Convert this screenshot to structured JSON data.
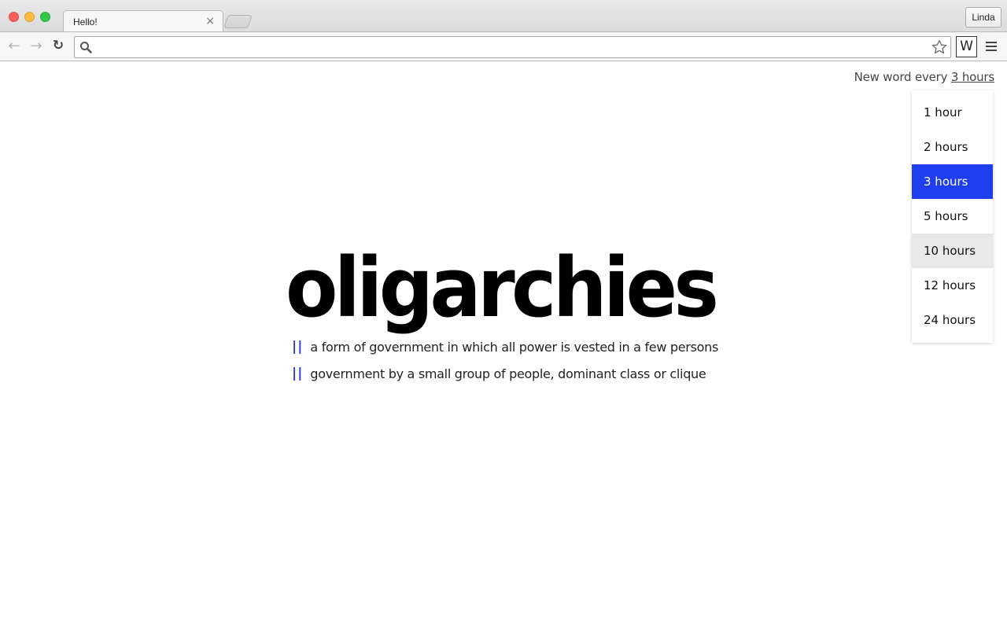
{
  "browser": {
    "tab_title": "Hello!",
    "tab_close": "×",
    "profile_name": "Linda",
    "address_value": "",
    "extension_label": "W",
    "nav": {
      "back_icon": "←",
      "forward_icon": "→",
      "reload_icon": "↻"
    }
  },
  "settings": {
    "prefix": "New word every ",
    "current": "3 hours",
    "options": [
      {
        "label": "1 hour",
        "state": "normal"
      },
      {
        "label": "2 hours",
        "state": "normal"
      },
      {
        "label": "3 hours",
        "state": "selected"
      },
      {
        "label": "5 hours",
        "state": "normal"
      },
      {
        "label": "10 hours",
        "state": "hover"
      },
      {
        "label": "12 hours",
        "state": "normal"
      },
      {
        "label": "24 hours",
        "state": "normal"
      }
    ]
  },
  "word": {
    "term": "oligarchies",
    "marker": "||",
    "definitions": [
      "a form of government in which all power is vested in a few persons",
      "government by a small group of people, dominant class or clique"
    ]
  },
  "colors": {
    "selected_option": "#1f3ef0",
    "hover_option": "#e8e8e8",
    "definition_marker": "#2b3bd8"
  }
}
